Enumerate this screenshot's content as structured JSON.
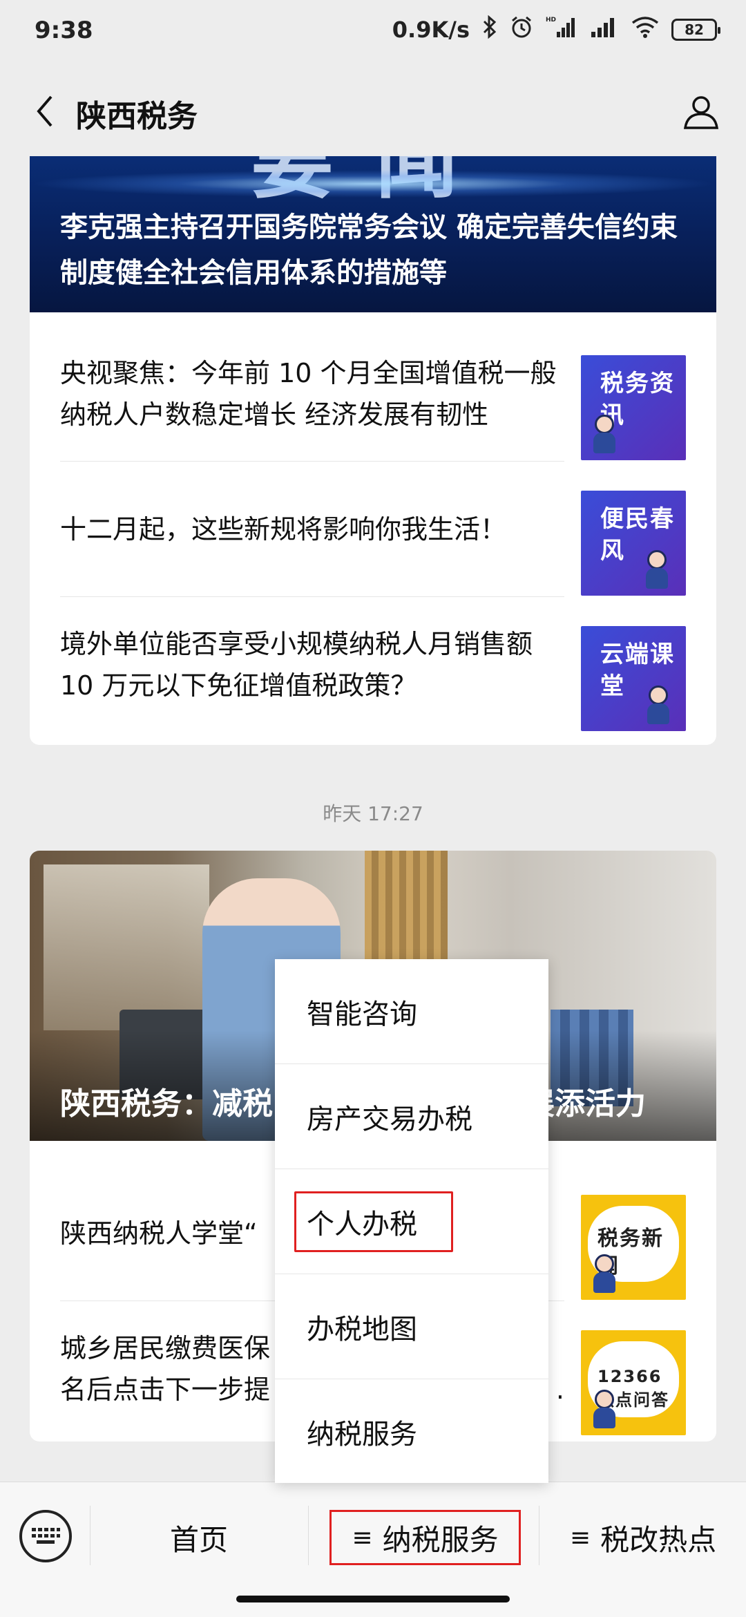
{
  "status_bar": {
    "time": "9:38",
    "network_speed": "0.9K/s",
    "battery": "82",
    "hd_label": "HD"
  },
  "nav": {
    "title": "陕西税务"
  },
  "article_group_1": {
    "hero_title": "李克强主持召开国务院常务会议 确定完善失信约束制度健全社会信用体系的措施等",
    "hero_big_text": "要闻",
    "items": [
      {
        "title": "央视聚焦：今年前 10 个月全国增值税一般纳税人户数稳定增长 经济发展有韧性",
        "thumb_label": "税务资讯"
      },
      {
        "title": "十二月起，这些新规将影响你我生活！",
        "thumb_label": "便民春风"
      },
      {
        "title": "境外单位能否享受小规模纳税人月销售额 10 万元以下免征增值税政策？",
        "thumb_label": "云端课堂"
      }
    ]
  },
  "timestamp": "昨天 17:27",
  "article_group_2": {
    "hero_caption_left": "陕西税务：减税",
    "hero_caption_right": "展添活力",
    "items": [
      {
        "title_left": "陕西纳税人学堂“",
        "thumb_label": "税务新闻"
      },
      {
        "title_left_1": "城乡居民缴费医保",
        "title_right_1": "：",
        "title_left_2": "名后点击下一步提",
        "title_right_2": ".",
        "thumb_label": "12366热点问答"
      }
    ]
  },
  "popup_menu": {
    "items": [
      "智能咨询",
      "房产交易办税",
      "个人办税",
      "办税地图",
      "纳税服务"
    ],
    "highlighted_index": 2
  },
  "bottom_menu": {
    "home": "首页",
    "tax_service": "纳税服务",
    "tax_reform": "税改热点",
    "menu_mark": "≡"
  },
  "colors": {
    "highlight": "#e02020",
    "thumb_blue": "#3a4dd8",
    "thumb_yellow": "#f6c20e"
  }
}
